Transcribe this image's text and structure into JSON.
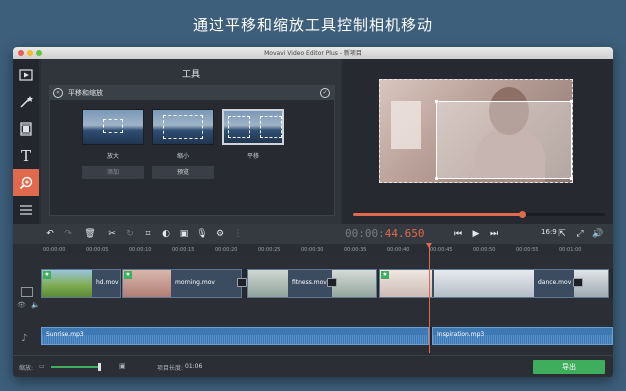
{
  "headline": "通过平移和缩放工具控制相机移动",
  "window": {
    "title": "Movavi Video Editor Plus - 新项目"
  },
  "sidebar": {
    "items": [
      {
        "icon": "import-media-icon"
      },
      {
        "icon": "magic-wand-icon"
      },
      {
        "icon": "film-filters-icon"
      },
      {
        "icon": "titles-icon",
        "label": "T"
      },
      {
        "icon": "pan-zoom-icon",
        "active": true
      },
      {
        "icon": "more-tools-icon"
      }
    ]
  },
  "panel": {
    "title": "工具",
    "section": "平移和缩放",
    "options": [
      {
        "label": "放大"
      },
      {
        "label": "缩小"
      },
      {
        "label": "平移",
        "selected": true
      }
    ],
    "add_button": "添加",
    "preview_button": "预览"
  },
  "player": {
    "timecode_dim": "00:00:",
    "timecode_hot": "44.650",
    "aspect": "16:9",
    "progress": 0.67
  },
  "timeline": {
    "ruler": [
      "00:00:00",
      "00:00:05",
      "00:00:10",
      "00:00:15",
      "00:00:20",
      "00:00:25",
      "00:00:30",
      "00:00:35",
      "00:00:40",
      "00:00:45",
      "00:00:50",
      "00:00:55",
      "00:01:00"
    ],
    "clips": [
      "hd.mov",
      "morning.mov",
      "fitness.mov",
      "dance.mov"
    ],
    "audio": [
      "Sunrise.mp3",
      "Inspiration.mp3"
    ]
  },
  "status": {
    "zoom_label": "缩放:",
    "zoom_level": 0.95,
    "duration_label": "项目长度:",
    "duration": "01:06",
    "export_label": "导出"
  },
  "colors": {
    "accent": "#e0694e",
    "export": "#3fae5c",
    "audio": "#3f79b3"
  }
}
